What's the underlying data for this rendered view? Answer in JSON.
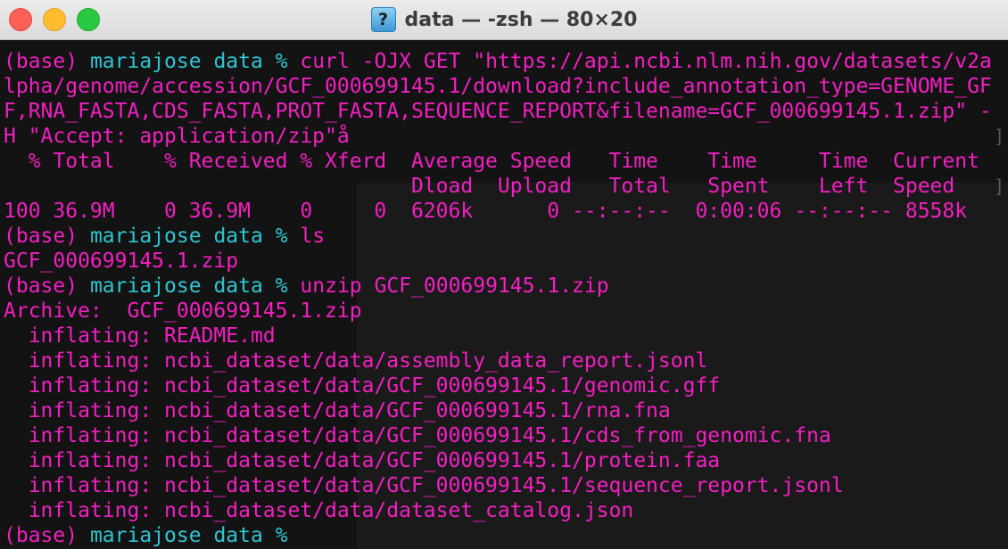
{
  "window": {
    "title": "data — -zsh — 80×20",
    "icon": "question-file-icon"
  },
  "terminal": {
    "prompt": {
      "env": "(base)",
      "user": "mariajose",
      "dir": "data",
      "symbol": "%"
    },
    "colors": {
      "prompt_cyan": "#2ec6d3",
      "text_magenta": "#f31fc2",
      "background": "#131313"
    },
    "lines": [
      {
        "prompt": true,
        "cmd": "curl -OJX GET \"https://api.ncbi.nlm.nih.gov/datasets/v2a"
      },
      {
        "text": "lpha/genome/accession/GCF_000699145.1/download?include_annotation_type=GENOME_GF"
      },
      {
        "text": "F,RNA_FASTA,CDS_FASTA,PROT_FASTA,SEQUENCE_REPORT&filename=GCF_000699145.1.zip\" -"
      },
      {
        "text": "H \"Accept: application/zip\"å",
        "bracket": "]"
      },
      {
        "text": "  % Total    % Received % Xferd  Average Speed   Time    Time     Time  Current"
      },
      {
        "text": "                                 Dload  Upload   Total   Spent    Left  Speed",
        "bracket": "]"
      },
      {
        "text": "100 36.9M    0 36.9M    0     0  6206k      0 --:--:--  0:00:06 --:--:-- 8558k"
      },
      {
        "prompt": true,
        "cmd": "ls"
      },
      {
        "text": "GCF_000699145.1.zip"
      },
      {
        "prompt": true,
        "cmd": "unzip GCF_000699145.1.zip"
      },
      {
        "text": "Archive:  GCF_000699145.1.zip"
      },
      {
        "text": "  inflating: README.md"
      },
      {
        "text": "  inflating: ncbi_dataset/data/assembly_data_report.jsonl"
      },
      {
        "text": "  inflating: ncbi_dataset/data/GCF_000699145.1/genomic.gff"
      },
      {
        "text": "  inflating: ncbi_dataset/data/GCF_000699145.1/rna.fna"
      },
      {
        "text": "  inflating: ncbi_dataset/data/GCF_000699145.1/cds_from_genomic.fna"
      },
      {
        "text": "  inflating: ncbi_dataset/data/GCF_000699145.1/protein.faa"
      },
      {
        "text": "  inflating: ncbi_dataset/data/GCF_000699145.1/sequence_report.jsonl"
      },
      {
        "text": "  inflating: ncbi_dataset/data/dataset_catalog.json"
      },
      {
        "prompt": true,
        "cmd": ""
      }
    ]
  }
}
